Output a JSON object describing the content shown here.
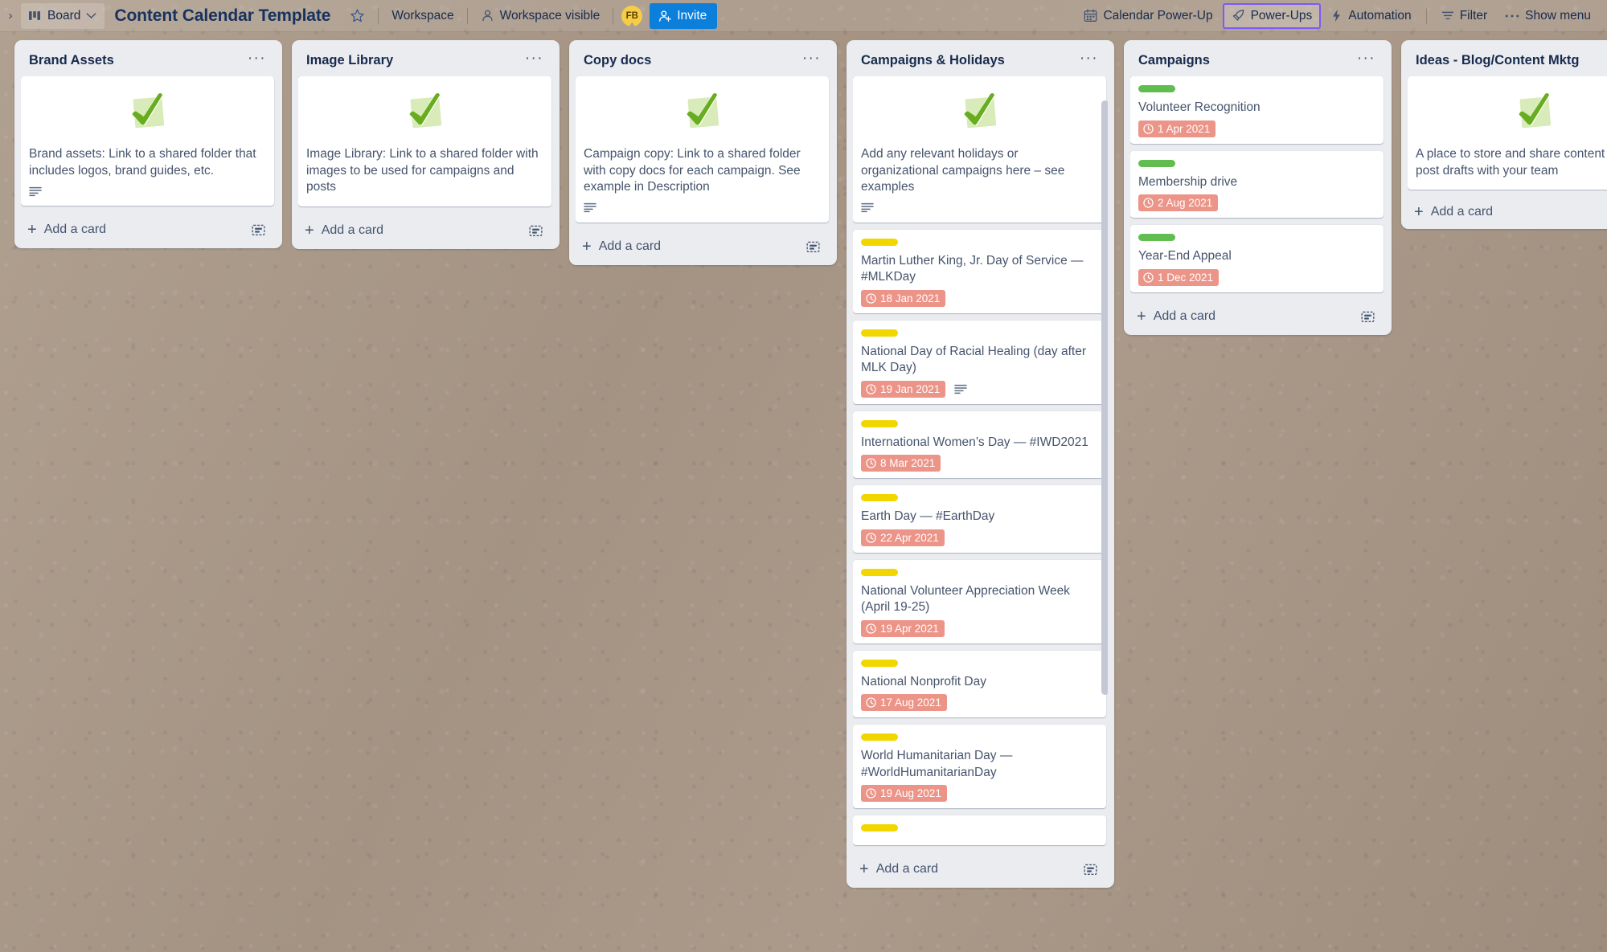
{
  "topbar": {
    "back_arrow": "›",
    "board_switcher_label": "Board",
    "board_switcher_icon": "board-icon",
    "chevron": "chevron-down-icon",
    "title": "Content Calendar Template",
    "star_icon": "star-icon",
    "workspace_label": "Workspace",
    "visibility_label": "Workspace visible",
    "visibility_icon": "members-icon",
    "avatar_initials": "FB",
    "invite_label": "Invite",
    "invite_icon": "add-member-icon",
    "invite_color": "#0c7fdb",
    "calendar_powerup_label": "Calendar Power-Up",
    "calendar_powerup_icon": "calendar-icon",
    "powerups_label": "Power-Ups",
    "powerups_icon": "rocket-icon",
    "powerups_outline_color": "#7a5af8",
    "automation_label": "Automation",
    "automation_icon": "bolt-icon",
    "filter_label": "Filter",
    "filter_icon": "filter-icon",
    "show_menu_label": "Show menu",
    "show_menu_icon": "ellipsis-icon"
  },
  "add_card_label": "Add a card",
  "colors": {
    "label_yellow": "#f2d600",
    "label_green": "#61bd4f",
    "due_red": "#ec9488",
    "list_bg": "#ebecf0",
    "board_bg": "#a89787"
  },
  "lists": [
    {
      "title": "Brand Assets",
      "has_template_icon": true,
      "scrollbar": false,
      "cards": [
        {
          "cover_check": true,
          "text": "Brand assets: Link to a shared folder that includes logos, brand guides, etc.",
          "has_description": true,
          "label": null,
          "due": null
        }
      ]
    },
    {
      "title": "Image Library",
      "has_template_icon": true,
      "scrollbar": false,
      "cards": [
        {
          "cover_check": true,
          "text": "Image Library: Link to a shared folder with images to be used for campaigns and posts",
          "has_description": false,
          "label": null,
          "due": null
        }
      ]
    },
    {
      "title": "Copy docs",
      "has_template_icon": true,
      "scrollbar": false,
      "cards": [
        {
          "cover_check": true,
          "text": "Campaign copy: Link to a shared folder with copy docs for each campaign. See example in Description",
          "has_description": true,
          "label": null,
          "due": null
        }
      ]
    },
    {
      "title": "Campaigns & Holidays",
      "has_template_icon": true,
      "scrollbar": true,
      "cards": [
        {
          "cover_check": true,
          "text": "Add any relevant holidays or organizational campaigns here – see examples",
          "has_description": true,
          "label": null,
          "due": null
        },
        {
          "cover_check": false,
          "text": "Martin Luther King, Jr. Day of Service — #MLKDay",
          "has_description": false,
          "label": "yellow",
          "due": "18 Jan 2021"
        },
        {
          "cover_check": false,
          "text": "National Day of Racial Healing (day after MLK Day)",
          "has_description": true,
          "label": "yellow",
          "due": "19 Jan 2021"
        },
        {
          "cover_check": false,
          "text": "International Women’s Day — #IWD2021",
          "has_description": false,
          "label": "yellow",
          "due": "8 Mar 2021"
        },
        {
          "cover_check": false,
          "text": "Earth Day — #EarthDay",
          "has_description": false,
          "label": "yellow",
          "due": "22 Apr 2021"
        },
        {
          "cover_check": false,
          "text": "National Volunteer Appreciation Week (April 19-25)",
          "has_description": false,
          "label": "yellow",
          "due": "19 Apr 2021"
        },
        {
          "cover_check": false,
          "text": "National Nonprofit Day",
          "has_description": false,
          "label": "yellow",
          "due": "17 Aug 2021"
        },
        {
          "cover_check": false,
          "text": "World Humanitarian Day — #WorldHumanitarianDay",
          "has_description": false,
          "label": "yellow",
          "due": "19 Aug 2021"
        },
        {
          "cover_check": false,
          "text": "",
          "has_description": false,
          "label": "yellow",
          "due": null
        }
      ]
    },
    {
      "title": "Campaigns",
      "has_template_icon": true,
      "scrollbar": false,
      "cards": [
        {
          "cover_check": false,
          "text": "Volunteer Recognition",
          "has_description": false,
          "label": "green",
          "due": "1 Apr 2021"
        },
        {
          "cover_check": false,
          "text": "Membership drive",
          "has_description": false,
          "label": "green",
          "due": "2 Aug 2021"
        },
        {
          "cover_check": false,
          "text": "Year-End Appeal",
          "has_description": false,
          "label": "green",
          "due": "1 Dec 2021"
        }
      ]
    },
    {
      "title": "Ideas - Blog/Content Mktg",
      "has_template_icon": false,
      "scrollbar": false,
      "cards": [
        {
          "cover_check": true,
          "text": "A place to store and share content ideas or post drafts with your team",
          "has_description": false,
          "label": null,
          "due": null
        }
      ]
    }
  ]
}
